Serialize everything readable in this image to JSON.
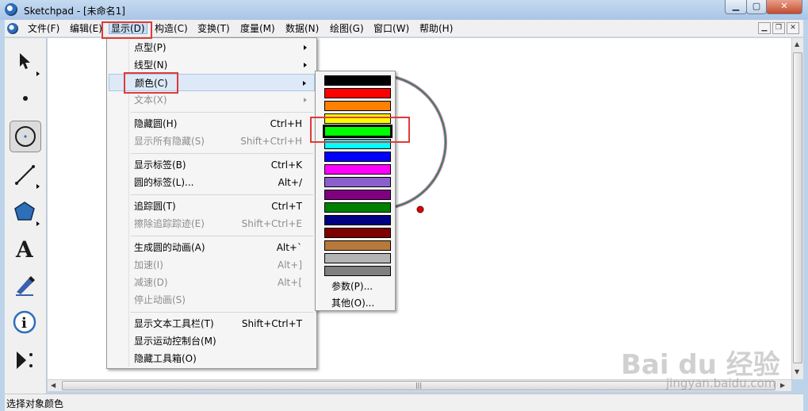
{
  "window": {
    "title": "Sketchpad - [未命名1]",
    "min_icon": "minimize-icon",
    "max_icon": "maximize-icon",
    "close_icon": "close-icon"
  },
  "menubar": {
    "items": [
      "文件(F)",
      "编辑(E)",
      "显示(D)",
      "构造(C)",
      "变换(T)",
      "度量(M)",
      "数据(N)",
      "绘图(G)",
      "窗口(W)",
      "帮助(H)"
    ],
    "active": "显示(D)"
  },
  "toolbox": {
    "tools": [
      "arrow-select-tool",
      "point-tool",
      "compass-circle-tool",
      "straightedge-tool",
      "polygon-tool",
      "text-tool",
      "marker-tool",
      "information-tool",
      "custom-tool"
    ],
    "text_tool_glyph": "A",
    "info_tool_glyph": "i",
    "selected": "compass-circle-tool"
  },
  "display_menu": {
    "items": [
      {
        "label": "点型(P)",
        "shortcut": "",
        "submenu": true,
        "enabled": true
      },
      {
        "label": "线型(N)",
        "shortcut": "",
        "submenu": true,
        "enabled": true
      },
      {
        "label": "颜色(C)",
        "shortcut": "",
        "submenu": true,
        "enabled": true,
        "highlighted": true
      },
      {
        "label": "文本(X)",
        "shortcut": "",
        "submenu": true,
        "enabled": false
      },
      {
        "label": "隐藏圆(H)",
        "shortcut": "Ctrl+H",
        "enabled": true
      },
      {
        "label": "显示所有隐藏(S)",
        "shortcut": "Shift+Ctrl+H",
        "enabled": false
      },
      {
        "label": "显示标签(B)",
        "shortcut": "Ctrl+K",
        "enabled": true
      },
      {
        "label": "圆的标签(L)...",
        "shortcut": "Alt+/",
        "enabled": true
      },
      {
        "label": "追踪圆(T)",
        "shortcut": "Ctrl+T",
        "enabled": true
      },
      {
        "label": "擦除追踪踪迹(E)",
        "shortcut": "Shift+Ctrl+E",
        "enabled": false
      },
      {
        "label": "生成圆的动画(A)",
        "shortcut": "Alt+`",
        "enabled": true
      },
      {
        "label": "加速(I)",
        "shortcut": "Alt+]",
        "enabled": false
      },
      {
        "label": "减速(D)",
        "shortcut": "Alt+[",
        "enabled": false
      },
      {
        "label": "停止动画(S)",
        "shortcut": "",
        "enabled": false
      },
      {
        "label": "显示文本工具栏(T)",
        "shortcut": "Shift+Ctrl+T",
        "enabled": true
      },
      {
        "label": "显示运动控制台(M)",
        "shortcut": "",
        "enabled": true
      },
      {
        "label": "隐藏工具箱(O)",
        "shortcut": "",
        "enabled": true
      }
    ]
  },
  "color_menu": {
    "swatches": [
      "#000000",
      "#ff0000",
      "#ff8000",
      "#ffff00",
      "#00ff00",
      "#00ffff",
      "#0000ff",
      "#ff00ff",
      "#8c5fcf",
      "#800080",
      "#008000",
      "#000080",
      "#800000",
      "#b87a3c",
      "#b4b4b4",
      "#808080"
    ],
    "selected_index": 4,
    "params_label": "参数(P)...",
    "other_label": "其他(O)..."
  },
  "canvas": {
    "circle_color": "#2e8b3a",
    "circle_outline_color": "#d77ad7",
    "point_color": "#e00000"
  },
  "status": {
    "text": "选择对象颜色"
  },
  "watermark": {
    "logo": "Bai du 经验",
    "url": "jingyan.baidu.com"
  }
}
